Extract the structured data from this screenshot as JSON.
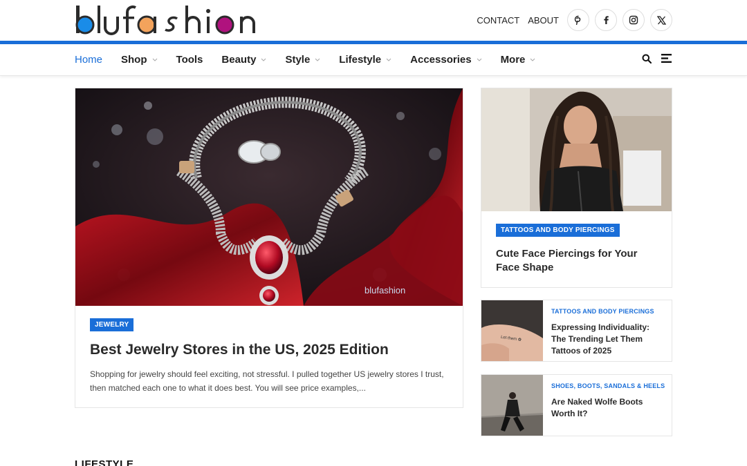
{
  "header": {
    "logo_text": "blufashion",
    "links": [
      "CONTACT",
      "ABOUT"
    ],
    "social_icons": [
      "pinterest-icon",
      "facebook-icon",
      "instagram-icon",
      "x-icon"
    ]
  },
  "nav": {
    "items": [
      {
        "label": "Home",
        "active": true,
        "dropdown": false
      },
      {
        "label": "Shop",
        "active": false,
        "dropdown": true
      },
      {
        "label": "Tools",
        "active": false,
        "dropdown": false
      },
      {
        "label": "Beauty",
        "active": false,
        "dropdown": true
      },
      {
        "label": "Style",
        "active": false,
        "dropdown": true
      },
      {
        "label": "Lifestyle",
        "active": false,
        "dropdown": true
      },
      {
        "label": "Accessories",
        "active": false,
        "dropdown": true
      },
      {
        "label": "More",
        "active": false,
        "dropdown": true
      }
    ],
    "right_icons": [
      "search-icon",
      "menu-icon"
    ]
  },
  "feature": {
    "category": "JEWELRY",
    "title": "Best Jewelry Stores in the US, 2025 Edition",
    "excerpt": "Shopping for jewelry should feel exciting, not stressful. I pulled together US jewelry stores I trust, then matched each one to what it does best. You will see price examples,...",
    "image_watermark": "blufashion"
  },
  "side_post": {
    "category": "TATTOOS AND BODY PIERCINGS",
    "title": "Cute Face Piercings for Your Face Shape"
  },
  "mini_posts": [
    {
      "category": "TATTOOS AND BODY PIERCINGS",
      "title": "Expressing Individuality: The Trending Let Them Tattoos of 2025"
    },
    {
      "category": "SHOES, BOOTS, SANDALS & HEELS",
      "title": "Are Naked Wolfe Boots Worth It?"
    }
  ],
  "section": {
    "label": "LIFESTYLE"
  },
  "colors": {
    "accent": "#1a6ed8",
    "logo_blue": "#1a8ce8",
    "logo_orange": "#f3a35c",
    "logo_magenta": "#b0127e"
  }
}
